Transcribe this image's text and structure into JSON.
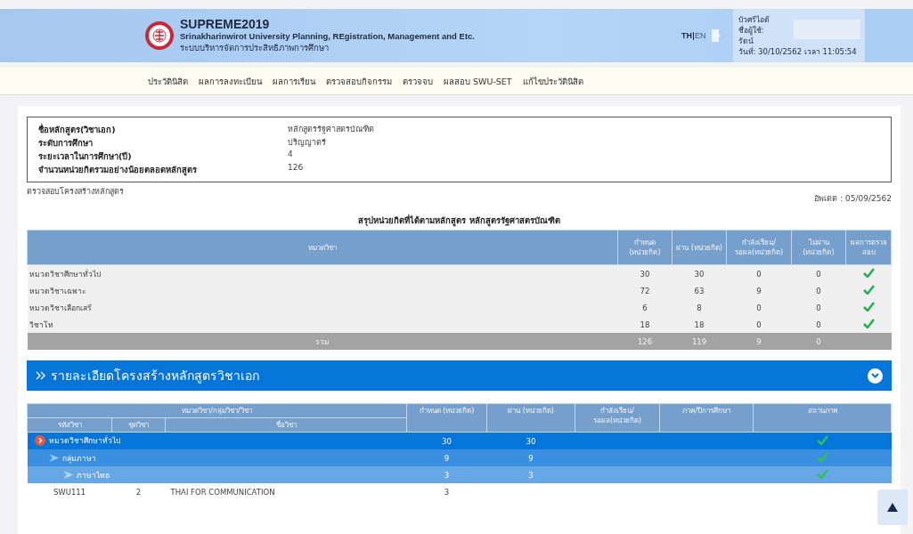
{
  "header": {
    "title": "SUPREME2019",
    "subtitle": "Srinakharinwirot University Planning, REgistration, Management and Etc.",
    "thai_subtitle": "ระบบบริหารจัดการประสิทธิภาพการศึกษา",
    "languages": [
      {
        "label": "TH",
        "selected": true
      },
      {
        "label": "EN",
        "selected": false
      }
    ],
    "user_lines": [
      "บัวศรีไอดี",
      "ชื่อผู้ใช้:",
      "รัตน์",
      "วันที่: 30/10/2562 เวลา 11:05:54"
    ]
  },
  "nav": [
    {
      "label": "ประวัตินิสิต"
    },
    {
      "label": "ผลการลงทะเบียน"
    },
    {
      "label": "ผลการเรียน"
    },
    {
      "label": "ตรวจสอบกิจกรรม"
    },
    {
      "label": "ตรวจจบ"
    },
    {
      "label": "ผลสอบ SWU-SET"
    },
    {
      "label": "แก้ไขประวัตินิสิต"
    }
  ],
  "program_info": [
    {
      "label": "ชื่อหลักสูตร(วิชาเอก)",
      "value": "หลักสูตรรัฐศาสตรบัณฑิต"
    },
    {
      "label": "ระดับการศึกษา",
      "value": "ปริญญาตรี"
    },
    {
      "label": "ระยะเวลาในการศึกษา(ปี)",
      "value": "4"
    },
    {
      "label": "จำนวนหน่วยกิตรวมอย่างน้อยตลอดหลักสูตร",
      "value": "126"
    }
  ],
  "check_link": "ตรวจสอบโครงสร้างหลักสูตร",
  "updated": "อัพเดต : 05/09/2562",
  "summary": {
    "title": "สรุปหน่วยกิตที่ได้ตามหลักสูตร  หลักสูตรรัฐศาสตรบัณฑิต",
    "columns": [
      "หมวดวิชา",
      "กำหนด (หน่วยกิต)",
      "ผ่าน (หน่วยกิต)",
      "กำลังเรียน/ รอผล(หน่วยกิต)",
      "ไม่ผ่าน (หน่วยกิต)",
      "ผลการตรวจ สอบ"
    ],
    "rows": [
      {
        "name": "หมวดวิชาศึกษาทั่วไป",
        "required": "30",
        "passed": "30",
        "studying": "0",
        "failed": "0",
        "ok": true
      },
      {
        "name": "หมวดวิชาเฉพาะ",
        "required": "72",
        "passed": "63",
        "studying": "9",
        "failed": "0",
        "ok": true
      },
      {
        "name": "หมวดวิชาเลือกเสรี",
        "required": "6",
        "passed": "8",
        "studying": "0",
        "failed": "0",
        "ok": true
      },
      {
        "name": "วิชาโท",
        "required": "18",
        "passed": "18",
        "studying": "0",
        "failed": "0",
        "ok": true
      }
    ],
    "total": {
      "name": "รวม",
      "required": "126",
      "passed": "119",
      "studying": "9",
      "failed": "0"
    }
  },
  "detail": {
    "title": "รายละเอียดโครงสร้างหลักสูตรวิชาเอก",
    "expanded": true,
    "group_header": "หมวดวิชา/กลุ่มวิชา/วิชา",
    "columns": [
      "รหัสวิชา",
      "ชุดวิชา",
      "ชื่อวิชา",
      "กำหนด (หน่วยกิต)",
      "ผ่าน (หน่วยกิต)",
      "กำลังเรียน/ รอผล(หน่วยกิต)",
      "ภาค/ปีการศึกษา",
      "สถานภาพ"
    ],
    "rows": [
      {
        "kind": "category",
        "name": "หมวดวิชาศึกษาทั่วไป",
        "required": "30",
        "passed": "30",
        "ok": true,
        "children": [
          {
            "kind": "group",
            "name": "กลุ่มภาษา",
            "required": "9",
            "passed": "9",
            "ok": true,
            "children": [
              {
                "kind": "subgroup",
                "name": "ภาษาไทย",
                "required": "3",
                "passed": "3",
                "ok": true,
                "children": [
                  {
                    "kind": "course",
                    "code": "SWU111",
                    "set": "2",
                    "name": "THAI FOR COMMUNICATION",
                    "required": "3",
                    "ok": false
                  }
                ]
              }
            ]
          }
        ]
      }
    ]
  }
}
